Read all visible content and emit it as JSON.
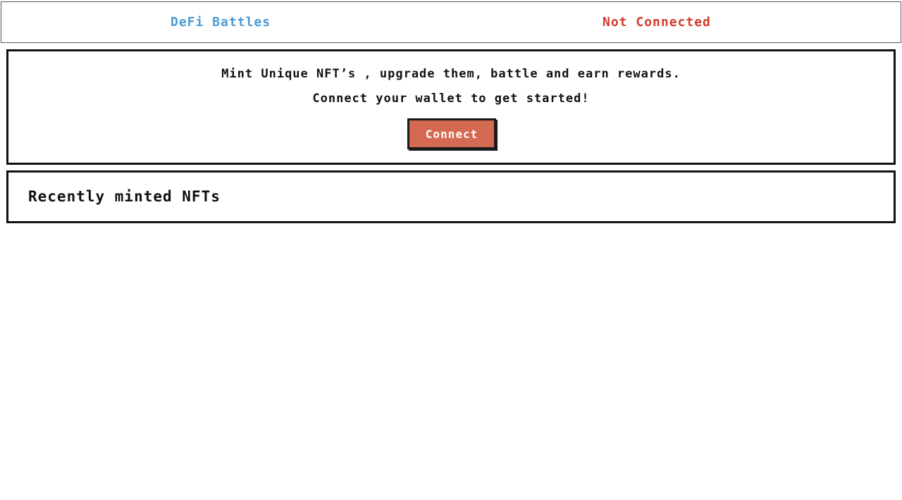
{
  "header": {
    "brand": "DeFi Battles",
    "status": "Not Connected"
  },
  "hero": {
    "line1": "Mint Unique NFT’s , upgrade them, battle and earn rewards.",
    "line2": "Connect your wallet to get started!",
    "connect_label": "Connect"
  },
  "recent": {
    "title": "Recently minted NFTs"
  },
  "colors": {
    "brand": "#4a9bd6",
    "status_error": "#d23a2a",
    "button": "#d46a52"
  }
}
